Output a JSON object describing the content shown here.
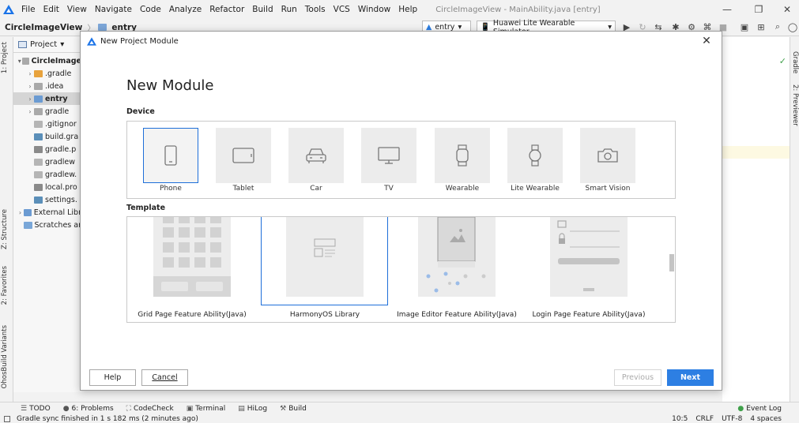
{
  "menubar": {
    "items": [
      "File",
      "Edit",
      "View",
      "Navigate",
      "Code",
      "Analyze",
      "Refactor",
      "Build",
      "Run",
      "Tools",
      "VCS",
      "Window",
      "Help"
    ],
    "window_title": "CircleImageView - MainAbility.java [entry]"
  },
  "navbar": {
    "project": "CircleImageView",
    "module": "entry",
    "config_select": "entry",
    "device_select": "Huawei Lite Wearable Simulator"
  },
  "left_tabs": {
    "project": "1: Project",
    "structure": "Z: Structure",
    "favorites": "2: Favorites",
    "build_variants": "OhosBuild Variants"
  },
  "right_tabs": {
    "gradle": "Gradle",
    "previewer": "2: Previewer"
  },
  "project_panel": {
    "header": "Project",
    "tree": [
      {
        "label": "CircleImage",
        "indent": 0,
        "arrow": "▾",
        "icon": "folder-icon",
        "bold": true
      },
      {
        "label": ".gradle",
        "indent": 1,
        "arrow": "›",
        "icon": "folder-orange-icon"
      },
      {
        "label": ".idea",
        "indent": 1,
        "arrow": "›",
        "icon": "folder-icon"
      },
      {
        "label": "entry",
        "indent": 1,
        "arrow": "›",
        "icon": "folder-module-icon",
        "bold": true,
        "selected": true
      },
      {
        "label": "gradle",
        "indent": 1,
        "arrow": "›",
        "icon": "folder-icon"
      },
      {
        "label": ".gitignor",
        "indent": 1,
        "arrow": "",
        "icon": "file-icon"
      },
      {
        "label": "build.gra",
        "indent": 1,
        "arrow": "",
        "icon": "gradle-file-icon"
      },
      {
        "label": "gradle.p",
        "indent": 1,
        "arrow": "",
        "icon": "properties-file-icon"
      },
      {
        "label": "gradlew",
        "indent": 1,
        "arrow": "",
        "icon": "file-icon"
      },
      {
        "label": "gradlew.",
        "indent": 1,
        "arrow": "",
        "icon": "file-icon"
      },
      {
        "label": "local.pro",
        "indent": 1,
        "arrow": "",
        "icon": "properties-file-icon"
      },
      {
        "label": "settings.",
        "indent": 1,
        "arrow": "",
        "icon": "gradle-file-icon"
      },
      {
        "label": "External Libr",
        "indent": 0,
        "arrow": "›",
        "icon": "library-icon"
      },
      {
        "label": "Scratches ar",
        "indent": 0,
        "arrow": "",
        "icon": "scratch-icon"
      }
    ]
  },
  "dialog": {
    "title": "New Project Module",
    "heading": "New Module",
    "device_section": "Device",
    "template_section": "Template",
    "devices": [
      {
        "label": "Phone",
        "icon": "phone-icon"
      },
      {
        "label": "Tablet",
        "icon": "tablet-icon"
      },
      {
        "label": "Car",
        "icon": "car-icon"
      },
      {
        "label": "TV",
        "icon": "tv-icon"
      },
      {
        "label": "Wearable",
        "icon": "wearable-icon"
      },
      {
        "label": "Lite Wearable",
        "icon": "lite-wearable-icon"
      },
      {
        "label": "Smart Vision",
        "icon": "camera-icon"
      }
    ],
    "selected_device": "Phone",
    "templates": [
      {
        "label": "Grid Page Feature Ability(Java)"
      },
      {
        "label": "HarmonyOS Library"
      },
      {
        "label": "Image Editor Feature Ability(Java)"
      },
      {
        "label": "Login Page Feature Ability(Java)"
      }
    ],
    "selected_template": "HarmonyOS Library",
    "buttons": {
      "help": "Help",
      "cancel": "Cancel",
      "previous": "Previous",
      "next": "Next"
    }
  },
  "bottom_tools": [
    {
      "label": "TODO",
      "icon": "todo-icon"
    },
    {
      "label": "6: Problems",
      "icon": "problems-icon"
    },
    {
      "label": "CodeCheck",
      "icon": "codecheck-icon"
    },
    {
      "label": "Terminal",
      "icon": "terminal-icon"
    },
    {
      "label": "HiLog",
      "icon": "hilog-icon"
    },
    {
      "label": "Build",
      "icon": "build-icon"
    }
  ],
  "event_log": "Event Log",
  "status": {
    "message": "Gradle sync finished in 1 s 182 ms (2 minutes ago)",
    "position": "10:5",
    "line_sep": "CRLF",
    "encoding": "UTF-8",
    "indent": "4 spaces"
  },
  "colors": {
    "accent": "#2d7fe3",
    "selection_border": "#1e6fd9"
  }
}
